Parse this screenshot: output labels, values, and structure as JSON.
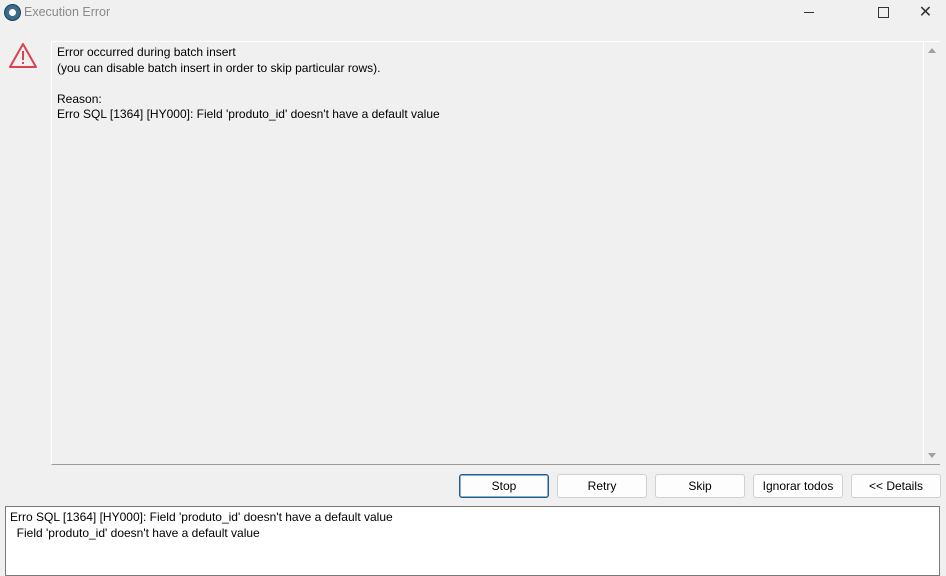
{
  "window": {
    "title": "Execution Error",
    "minimize_icon": "minimize-icon",
    "maximize_icon": "maximize-icon",
    "close_icon": "close-icon"
  },
  "message": {
    "icon": "warning-triangle-icon",
    "lines": [
      "Error occurred during batch insert",
      "(you can disable batch insert in order to skip particular rows).",
      "",
      "Reason:",
      "Erro SQL [1364] [HY000]: Field 'produto_id' doesn't have a default value"
    ]
  },
  "buttons": {
    "stop": "Stop",
    "retry": "Retry",
    "skip": "Skip",
    "ignore_all": "Ignorar todos",
    "details": "<< Details"
  },
  "details": {
    "lines": [
      "Erro SQL [1364] [HY000]: Field 'produto_id' doesn't have a default value",
      "  Field 'produto_id' doesn't have a default value"
    ]
  },
  "colors": {
    "warning": "#d9434f",
    "default_button_border": "#1c5f8e"
  }
}
